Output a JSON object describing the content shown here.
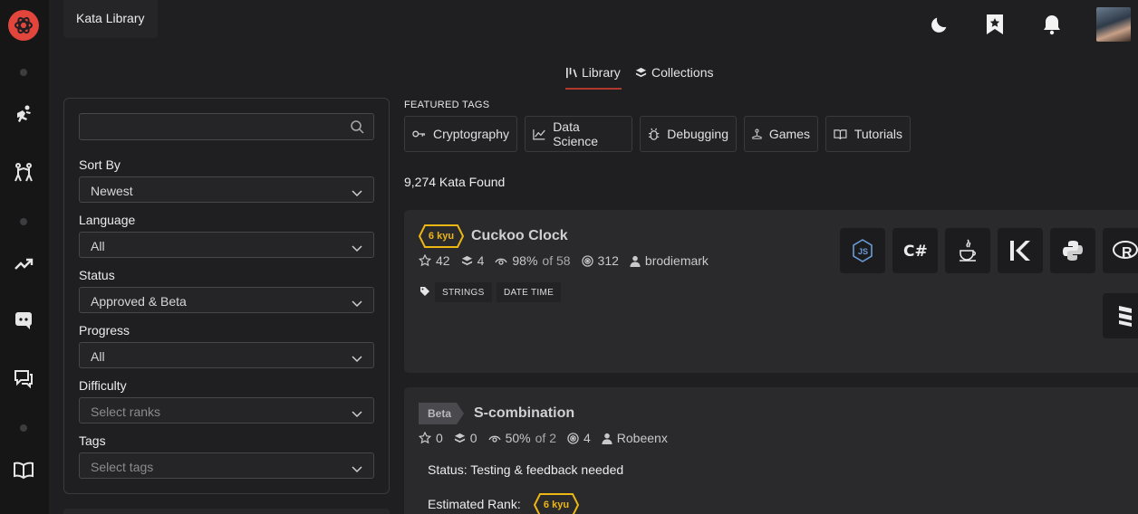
{
  "app": {
    "name": "Kata Library"
  },
  "header": {
    "icons": [
      "moon-icon",
      "bookmark-star-icon",
      "bell-icon"
    ],
    "avatar": "user-avatar"
  },
  "rail": {
    "icons": [
      "logo-icon",
      "train-icon",
      "sparring-icon",
      "leaderboard-icon",
      "discord-icon",
      "discussions-icon",
      "docs-icon"
    ]
  },
  "tabs": [
    {
      "label": "Library",
      "active": true
    },
    {
      "label": "Collections",
      "active": false
    }
  ],
  "filters": {
    "search_placeholder": "",
    "sort_by": {
      "label": "Sort By",
      "value": "Newest"
    },
    "language": {
      "label": "Language",
      "value": "All"
    },
    "status": {
      "label": "Status",
      "value": "Approved & Beta"
    },
    "progress": {
      "label": "Progress",
      "value": "All"
    },
    "difficulty": {
      "label": "Difficulty",
      "placeholder": "Select ranks"
    },
    "tags": {
      "label": "Tags",
      "placeholder": "Select tags"
    }
  },
  "featured_tags": {
    "title": "FEATURED TAGS",
    "items": [
      {
        "label": "Cryptography",
        "icon": "key-icon"
      },
      {
        "label": "Data Science",
        "icon": "line-chart-icon"
      },
      {
        "label": "Debugging",
        "icon": "bug-icon"
      },
      {
        "label": "Games",
        "icon": "joystick-icon"
      },
      {
        "label": "Tutorials",
        "icon": "book-icon"
      }
    ]
  },
  "results": {
    "count_text": "9,274 Kata Found"
  },
  "katas": [
    {
      "rank": "6 kyu",
      "title": "Cuckoo Clock",
      "stars": "42",
      "collections": "4",
      "satisfaction": "98%",
      "satisfaction_of": "of 58",
      "completed": "312",
      "author": "brodiemark",
      "tags": [
        "STRINGS",
        "DATE TIME"
      ],
      "languages": [
        "javascript-icon",
        "csharp-icon",
        "java-icon",
        "kotlin-icon",
        "python-icon",
        "r-icon",
        "scala-icon"
      ]
    },
    {
      "rank": "Beta",
      "title": "S-combination",
      "stars": "0",
      "collections": "0",
      "satisfaction": "50%",
      "satisfaction_of": "of 2",
      "completed": "4",
      "author": "Robeenx",
      "status_label": "Status:",
      "status_value": "Testing & feedback needed",
      "estimated_label": "Estimated Rank:",
      "estimated_rank": "6 kyu"
    }
  ],
  "colors": {
    "accent": "#b1382f",
    "rank_yellow": "#ecb613",
    "background": "#1f1f21",
    "card": "#2a2a2d",
    "logo": "#e2453c"
  }
}
